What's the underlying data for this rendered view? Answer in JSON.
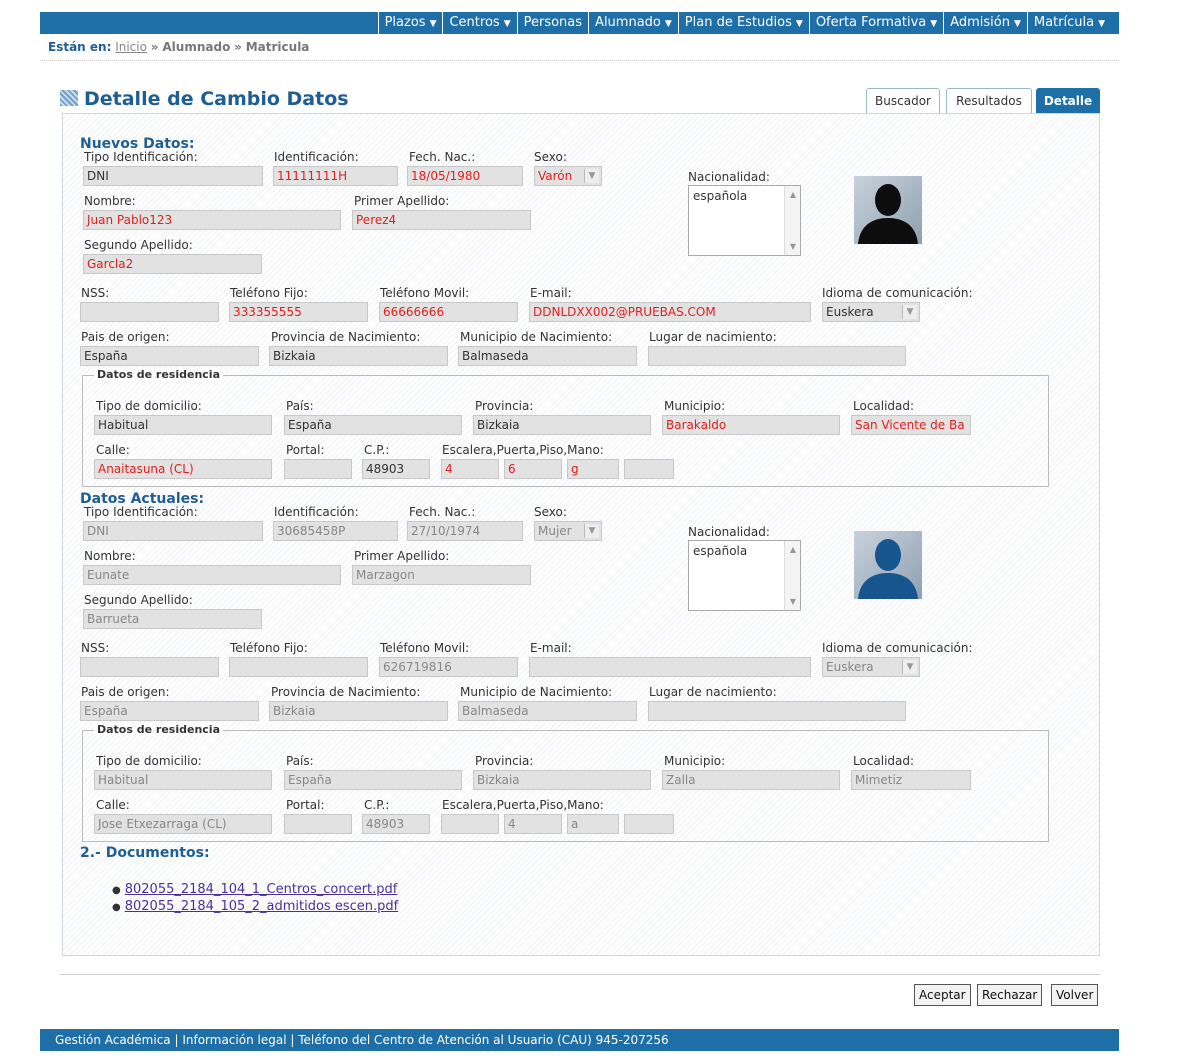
{
  "nav": {
    "items": [
      "Plazos",
      "Centros",
      "Personas",
      "Alumnado",
      "Plan de Estudios",
      "Oferta Formativa",
      "Admisión",
      "Matrícula"
    ],
    "dropdown": [
      true,
      true,
      false,
      true,
      true,
      true,
      true,
      true
    ]
  },
  "breadcrumb": {
    "label": "Están en:",
    "home": "Inicio",
    "sep": "»",
    "level1": "Alumnado",
    "level2": "Matricula"
  },
  "title": "Detalle de Cambio Datos",
  "tabs": {
    "buscador": "Buscador",
    "resultados": "Resultados",
    "detalle": "Detalle"
  },
  "nuevos": {
    "heading": "Nuevos Datos:",
    "labels": {
      "tipo_id": "Tipo Identificación:",
      "id": "Identificación:",
      "fech": "Fech. Nac.:",
      "sexo": "Sexo:",
      "nacionalidad": "Nacionalidad:",
      "nombre": "Nombre:",
      "apellido1": "Primer Apellido:",
      "apellido2": "Segundo Apellido:",
      "nss": "NSS:",
      "tel_fijo": "Teléfono Fijo:",
      "tel_movil": "Teléfono Movil:",
      "email": "E-mail:",
      "idioma": "Idioma de comunicación:",
      "pais_origen": "Pais de origen:",
      "prov_nac": "Provincia de Nacimiento:",
      "mun_nac": "Municipio de Nacimiento:",
      "lugar_nac": "Lugar de nacimiento:",
      "residencia": "Datos de residencia",
      "tipo_dom": "Tipo de domicilio:",
      "pais": "País:",
      "provincia": "Provincia:",
      "municipio": "Municipio:",
      "localidad": "Localidad:",
      "calle": "Calle:",
      "portal": "Portal:",
      "cp": "C.P.:",
      "escalera": "Escalera,Puerta,Piso,Mano:"
    },
    "values": {
      "tipo_id": "DNI",
      "id": "11111111H",
      "fech": "18/05/1980",
      "sexo": "Varón",
      "nacionalidad": "española",
      "nombre": "Juan Pablo123",
      "apellido1": "Perez4",
      "apellido2": "Garcla2",
      "nss": "",
      "tel_fijo": "333355555",
      "tel_movil": "66666666",
      "email": "DDNLDXX002@PRUEBAS.COM",
      "idioma": "Euskera",
      "pais_origen": "España",
      "prov_nac": "Bizkaia",
      "mun_nac": "Balmaseda",
      "lugar_nac": "",
      "tipo_dom": "Habitual",
      "pais": "España",
      "provincia": "Bizkaia",
      "municipio": "Barakaldo",
      "localidad": "San Vicente de Ba",
      "calle": "Anaitasuna (CL)",
      "portal": "",
      "cp": "48903",
      "esc1": "4",
      "esc2": "6",
      "esc3": "g",
      "esc4": ""
    }
  },
  "actuales": {
    "heading": "Datos Actuales:",
    "values": {
      "tipo_id": "DNI",
      "id": "30685458P",
      "fech": "27/10/1974",
      "sexo": "Mujer",
      "nacionalidad": "española",
      "nombre": "Eunate",
      "apellido1": "Marzagon",
      "apellido2": "Barrueta",
      "nss": "",
      "tel_fijo": "",
      "tel_movil": "626719816",
      "email": "",
      "idioma": "Euskera",
      "pais_origen": "España",
      "prov_nac": "Bizkaia",
      "mun_nac": "Balmaseda",
      "lugar_nac": "",
      "tipo_dom": "Habitual",
      "pais": "España",
      "provincia": "Bizkaia",
      "municipio": "Zalla",
      "localidad": "Mimetiz",
      "calle": "Jose Etxezarraga (CL)",
      "portal": "",
      "cp": "48903",
      "esc1": "",
      "esc2": "4",
      "esc3": "a",
      "esc4": ""
    }
  },
  "documentos": {
    "heading": "2.- Documentos:",
    "files": [
      "802055_2184_104_1_Centros_concert.pdf",
      "802055_2184_105_2_admitidos escen.pdf"
    ]
  },
  "buttons": {
    "aceptar": "Aceptar",
    "rechazar": "Rechazar",
    "volver": "Volver"
  },
  "footer": "Gestión Académica | Información legal | Teléfono del Centro de Atención al Usuario (CAU) 945-207256",
  "colors": {
    "nav_blue": "#1e6ea8",
    "title_blue": "#1e5e95",
    "changed_red": "#e0201d"
  }
}
